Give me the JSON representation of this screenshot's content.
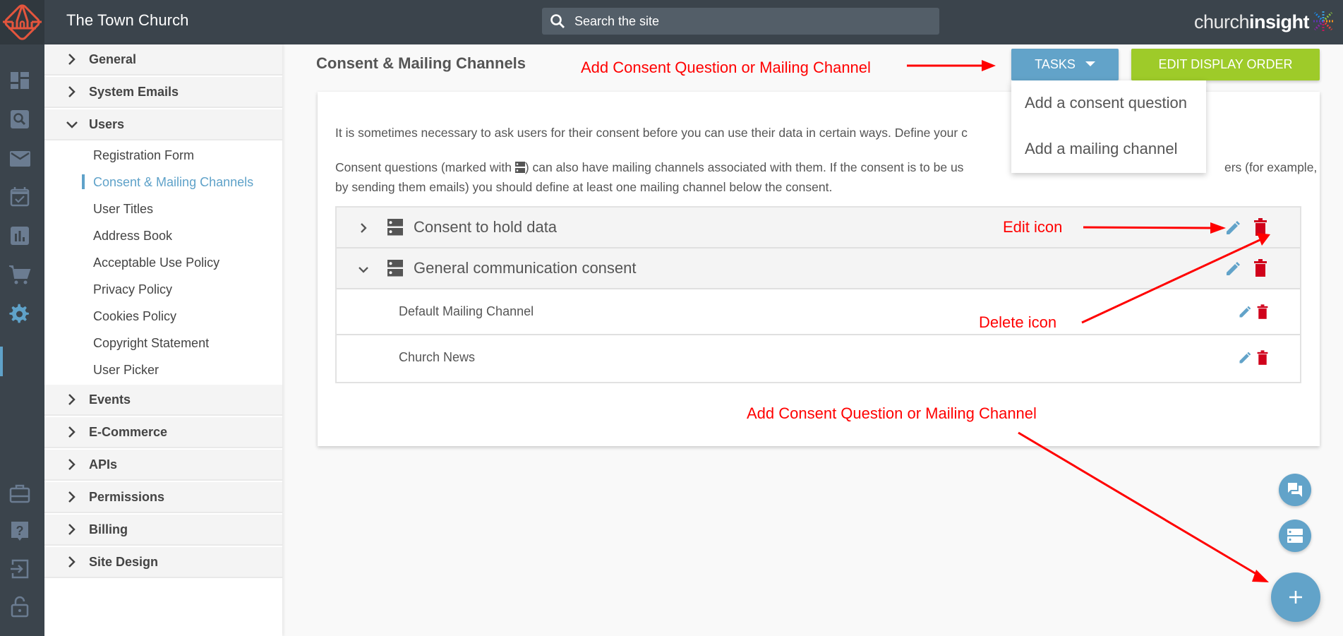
{
  "header": {
    "site_title": "The Town Church",
    "search_placeholder": "Search the site",
    "brand_light": "church",
    "brand_bold": "insight"
  },
  "rail": {
    "icons": [
      "dashboard-icon",
      "search-icon",
      "mail-icon",
      "calendar-check-icon",
      "chart-icon",
      "cart-icon",
      "settings-icon",
      "briefcase-icon",
      "help-icon",
      "logout-icon",
      "lock-icon"
    ],
    "active": "settings-icon"
  },
  "sidebar": {
    "sections_top": [
      {
        "label": "General",
        "expanded": false
      },
      {
        "label": "System Emails",
        "expanded": false
      },
      {
        "label": "Users",
        "expanded": true
      }
    ],
    "users_items": [
      {
        "label": "Registration Form",
        "active": false
      },
      {
        "label": "Consent & Mailing Channels",
        "active": true
      },
      {
        "label": "User Titles",
        "active": false
      },
      {
        "label": "Address Book",
        "active": false
      },
      {
        "label": "Acceptable Use Policy",
        "active": false
      },
      {
        "label": "Privacy Policy",
        "active": false
      },
      {
        "label": "Cookies Policy",
        "active": false
      },
      {
        "label": "Copyright Statement",
        "active": false
      },
      {
        "label": "User Picker",
        "active": false
      }
    ],
    "sections_bottom": [
      {
        "label": "Events"
      },
      {
        "label": "E-Commerce"
      },
      {
        "label": "APIs"
      },
      {
        "label": "Permissions"
      },
      {
        "label": "Billing"
      },
      {
        "label": "Site Design"
      }
    ]
  },
  "main": {
    "title": "Consent & Mailing Channels",
    "tasks_label": "TASKS",
    "edit_order_label": "EDIT DISPLAY ORDER",
    "tasks_menu": [
      "Add a consent question",
      "Add a mailing channel"
    ],
    "para1": "It is sometimes necessary to ask users for their consent before you can use their data in certain ways. Define your c",
    "para2_before": "Consent questions (marked with ",
    "para2_after": ") can also have mailing channels associated with them. If the consent is to be us",
    "para2_tail": "ers (for example,",
    "para3": "by sending them emails) you should define at least one mailing channel below the consent.",
    "questions": [
      {
        "label": "Consent to hold data",
        "expanded": false,
        "channels": []
      },
      {
        "label": "General communication consent",
        "expanded": true,
        "channels": [
          "Default Mailing Channel",
          "Church News"
        ]
      }
    ]
  },
  "annotations": {
    "top": "Add Consent Question or Mailing Channel",
    "edit": "Edit icon",
    "delete": "Delete icon",
    "bottom": "Add Consent Question or Mailing Channel"
  },
  "colors": {
    "accent": "#62a3c9",
    "green": "#9ecb29",
    "delete": "#d0021b",
    "annotation": "#ff0000",
    "topbar": "#3b444c"
  }
}
